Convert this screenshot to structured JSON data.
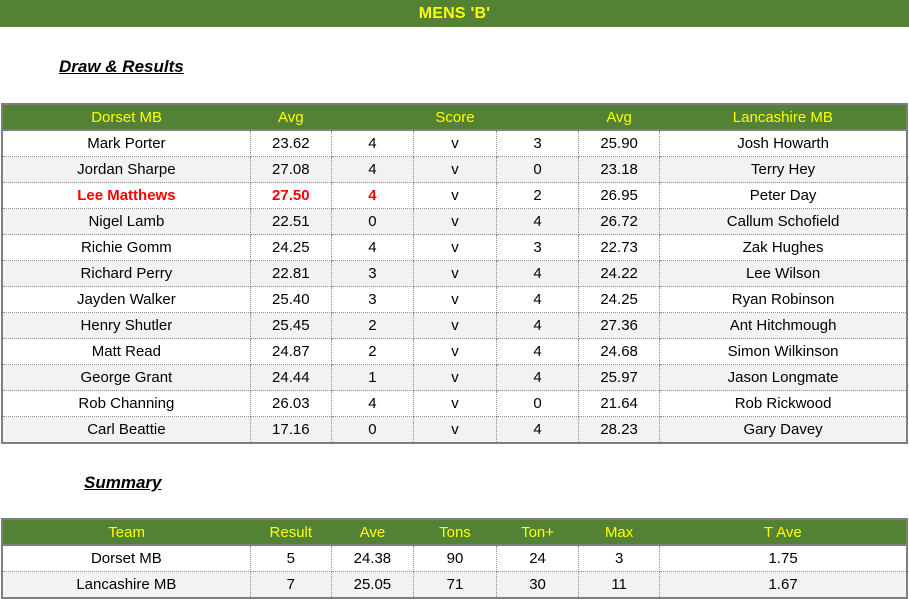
{
  "title": "MENS 'B'",
  "draw_heading": "Draw & Results",
  "summary_heading": "Summary",
  "colors": {
    "header_bg": "#548235",
    "header_text": "#ffff00",
    "highlight_text": "#ff0000",
    "alt_row_bg": "#f2f2f2"
  },
  "draw": {
    "headers": {
      "home_team": "Dorset MB",
      "home_avg": "Avg",
      "score": "Score",
      "away_avg": "Avg",
      "away_team": "Lancashire MB"
    },
    "rows": [
      {
        "home": "Mark Porter",
        "home_avg": "23.62",
        "home_score": "4",
        "vs": "v",
        "away_score": "3",
        "away_avg": "25.90",
        "away": "Josh Howarth",
        "highlight": false
      },
      {
        "home": "Jordan Sharpe",
        "home_avg": "27.08",
        "home_score": "4",
        "vs": "v",
        "away_score": "0",
        "away_avg": "23.18",
        "away": "Terry Hey",
        "highlight": false
      },
      {
        "home": "Lee Matthews",
        "home_avg": "27.50",
        "home_score": "4",
        "vs": "v",
        "away_score": "2",
        "away_avg": "26.95",
        "away": "Peter Day",
        "highlight": true
      },
      {
        "home": "Nigel Lamb",
        "home_avg": "22.51",
        "home_score": "0",
        "vs": "v",
        "away_score": "4",
        "away_avg": "26.72",
        "away": "Callum Schofield",
        "highlight": false
      },
      {
        "home": "Richie Gomm",
        "home_avg": "24.25",
        "home_score": "4",
        "vs": "v",
        "away_score": "3",
        "away_avg": "22.73",
        "away": "Zak Hughes",
        "highlight": false
      },
      {
        "home": "Richard Perry",
        "home_avg": "22.81",
        "home_score": "3",
        "vs": "v",
        "away_score": "4",
        "away_avg": "24.22",
        "away": "Lee Wilson",
        "highlight": false
      },
      {
        "home": "Jayden Walker",
        "home_avg": "25.40",
        "home_score": "3",
        "vs": "v",
        "away_score": "4",
        "away_avg": "24.25",
        "away": "Ryan Robinson",
        "highlight": false
      },
      {
        "home": "Henry Shutler",
        "home_avg": "25.45",
        "home_score": "2",
        "vs": "v",
        "away_score": "4",
        "away_avg": "27.36",
        "away": "Ant Hitchmough",
        "highlight": false
      },
      {
        "home": "Matt Read",
        "home_avg": "24.87",
        "home_score": "2",
        "vs": "v",
        "away_score": "4",
        "away_avg": "24.68",
        "away": "Simon Wilkinson",
        "highlight": false
      },
      {
        "home": "George Grant",
        "home_avg": "24.44",
        "home_score": "1",
        "vs": "v",
        "away_score": "4",
        "away_avg": "25.97",
        "away": "Jason Longmate",
        "highlight": false
      },
      {
        "home": "Rob Channing",
        "home_avg": "26.03",
        "home_score": "4",
        "vs": "v",
        "away_score": "0",
        "away_avg": "21.64",
        "away": "Rob Rickwood",
        "highlight": false
      },
      {
        "home": "Carl Beattie",
        "home_avg": "17.16",
        "home_score": "0",
        "vs": "v",
        "away_score": "4",
        "away_avg": "28.23",
        "away": "Gary Davey",
        "highlight": false
      }
    ]
  },
  "summary": {
    "headers": [
      "Team",
      "Result",
      "Ave",
      "Tons",
      "Ton+",
      "Max",
      "T Ave"
    ],
    "rows": [
      [
        "Dorset MB",
        "5",
        "24.38",
        "90",
        "24",
        "3",
        "1.75"
      ],
      [
        "Lancashire MB",
        "7",
        "25.05",
        "71",
        "30",
        "11",
        "1.67"
      ]
    ]
  }
}
